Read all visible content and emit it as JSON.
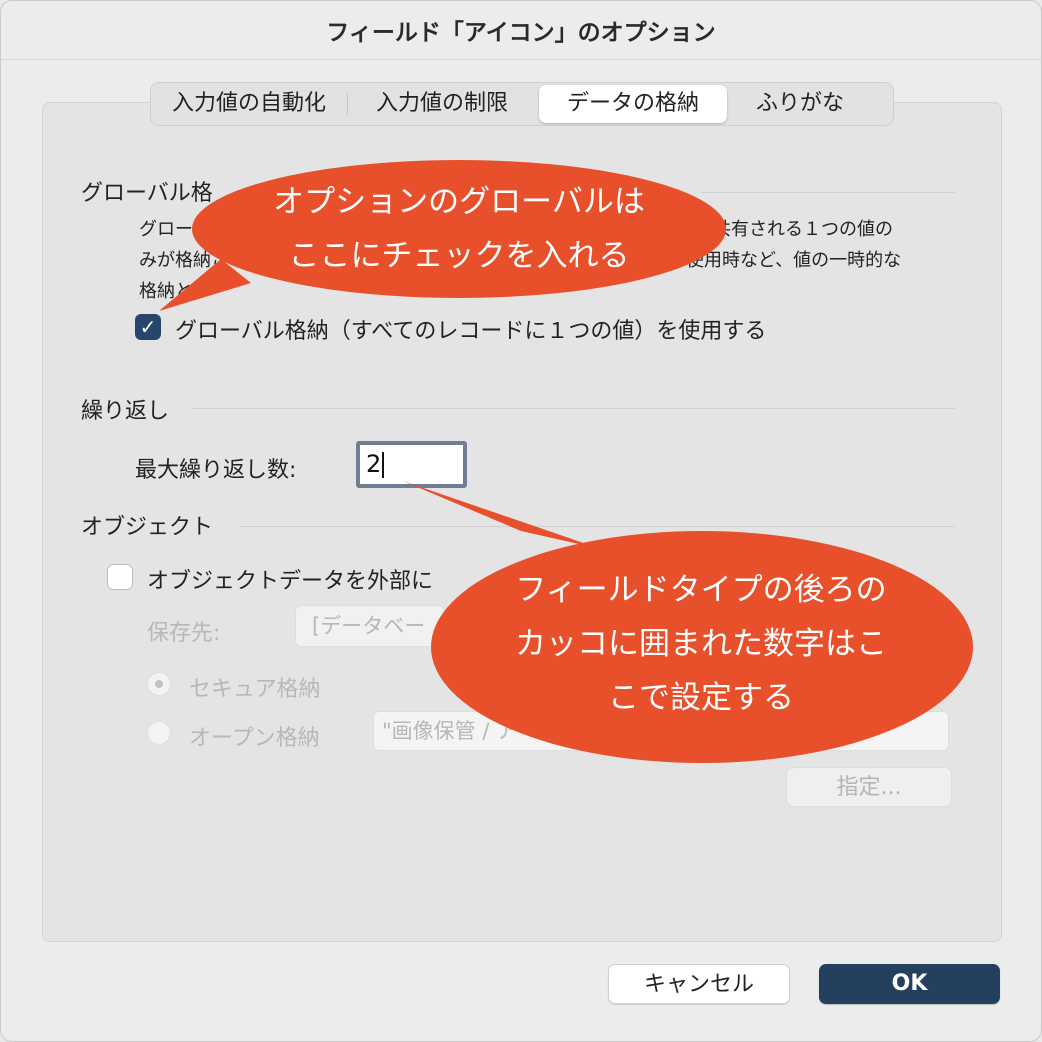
{
  "window": {
    "title": "フィールド「アイコン」のオプション"
  },
  "tabs": [
    {
      "label": "入力値の自動化",
      "selected": false
    },
    {
      "label": "入力値の制限",
      "selected": false
    },
    {
      "label": "データの格納",
      "selected": true
    },
    {
      "label": "ふりがな",
      "selected": false
    }
  ],
  "global": {
    "section_label": "グローバル格",
    "desc_line1": "グロー",
    "desc_line1_end": "共有される１つの値の",
    "desc_line2": "みが格納さ",
    "desc_line2_end": "使用時など、値の一時的な",
    "desc_line3": "格納と",
    "checkbox_label": "グローバル格納（すべてのレコードに１つの値）を使用する",
    "checked": true
  },
  "repeat": {
    "section_label": "繰り返し",
    "max_label": "最大繰り返し数:",
    "max_value": "2"
  },
  "object": {
    "section_label": "オブジェクト",
    "external_label": "オブジェクトデータを外部に",
    "save_to_label": "保存先:",
    "save_to_value": "[データベー",
    "secure_label": "セキュア格納",
    "open_label": "オープン格納",
    "path_value": "\"画像保管 / ア",
    "specify_button": "指定..."
  },
  "buttons": {
    "cancel": "キャンセル",
    "ok": "OK"
  },
  "callouts": {
    "top_line1": "オプションのグローバルは",
    "top_line2": "ここにチェックを入れる",
    "bottom_line1": "フィールドタイプの後ろの",
    "bottom_line2": "カッコに囲まれた数字はこ",
    "bottom_line3": "こで設定する",
    "color": "#e8502c"
  },
  "colors": {
    "ok_button": "#23405f",
    "checkbox": "#28456b",
    "focus_ring": "#6f7e92"
  }
}
